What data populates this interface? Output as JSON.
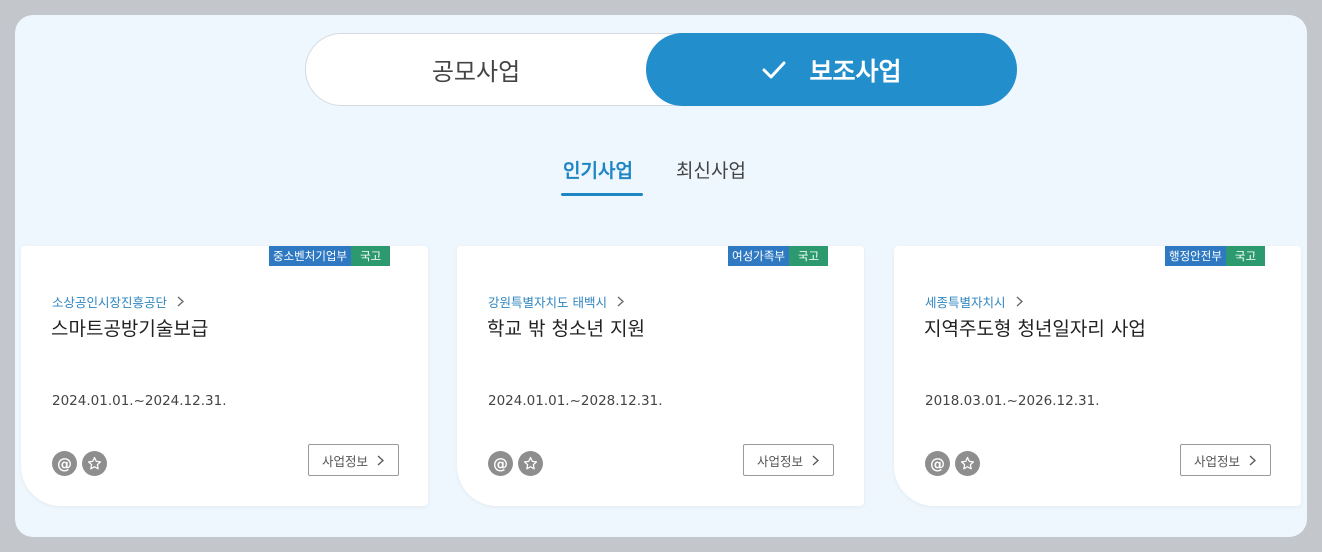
{
  "toggle": {
    "left_label": "공모사업",
    "right_label": "보조사업",
    "selected": "right"
  },
  "tabs": [
    {
      "label": "인기사업",
      "active": true
    },
    {
      "label": "최신사업",
      "active": false
    }
  ],
  "cards": [
    {
      "department": "중소벤처기업부",
      "kind": "국고",
      "agency": "소상공인시장진흥공단",
      "title": "스마트공방기술보급",
      "period": "2024.01.01.~2024.12.31.",
      "info_button": "사업정보"
    },
    {
      "department": "여성가족부",
      "kind": "국고",
      "agency": "강원특별자치도 태백시",
      "title": "학교 밖 청소년 지원",
      "period": "2024.01.01.~2028.12.31.",
      "info_button": "사업정보"
    },
    {
      "department": "행정안전부",
      "kind": "국고",
      "agency": "세종특별자치시",
      "title": "지역주도형 청년일자리 사업",
      "period": "2018.03.01.~2026.12.31.",
      "info_button": "사업정보"
    }
  ],
  "icons": {
    "email": "@",
    "favorite": "star-icon",
    "selected_check": "check-icon",
    "link_arrow": "chevron-right-icon"
  },
  "colors": {
    "accent_blue": "#228ecb",
    "tab_active": "#1f86c4",
    "badge_department": "#2f79c3",
    "badge_kind": "#2c9a6e",
    "panel_background": "#eff7fe"
  }
}
